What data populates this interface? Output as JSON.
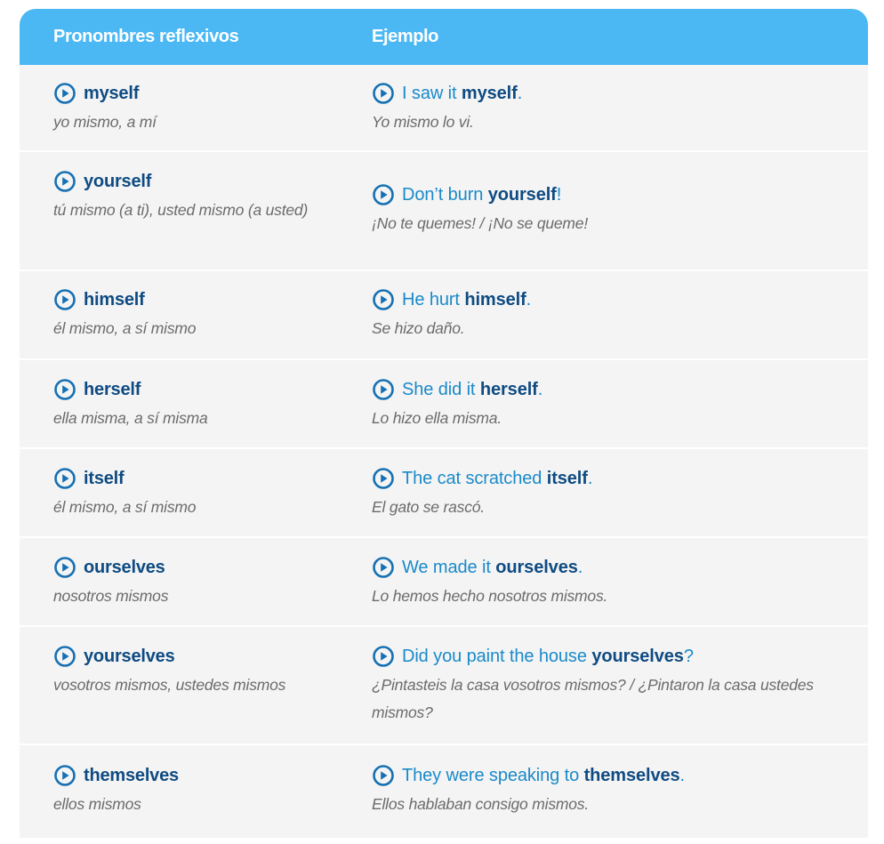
{
  "header": {
    "col1": "Pronombres reflexivos",
    "col2": "Ejemplo"
  },
  "icons": {
    "play": "play-circle-icon"
  },
  "colors": {
    "header_bg": "#4bb8f4",
    "row_bg": "#f4f4f4",
    "word": "#0f4b82",
    "sentence": "#1a8ac9",
    "translation": "#6b6b6b"
  },
  "rows": [
    {
      "pronoun": "myself",
      "pronoun_translation": "yo mismo, a mí",
      "ex_pre": "I saw it ",
      "ex_bold": "myself",
      "ex_post": ".",
      "ex_translation": "Yo mismo lo vi."
    },
    {
      "pronoun": "yourself",
      "pronoun_translation": "tú mismo (a ti), usted mismo (a usted)",
      "ex_pre": "Don’t burn ",
      "ex_bold": "yourself",
      "ex_post": "!",
      "ex_translation": "¡No te quemes! / ¡No se queme!"
    },
    {
      "pronoun": "himself",
      "pronoun_translation": "él mismo, a sí mismo",
      "ex_pre": "He hurt ",
      "ex_bold": "himself",
      "ex_post": ".",
      "ex_translation": "Se hizo daño."
    },
    {
      "pronoun": "herself",
      "pronoun_translation": "ella misma, a sí misma",
      "ex_pre": "She did it ",
      "ex_bold": "herself",
      "ex_post": ".",
      "ex_translation": "Lo hizo ella misma."
    },
    {
      "pronoun": "itself",
      "pronoun_translation": "él mismo, a sí mismo",
      "ex_pre": "The cat scratched ",
      "ex_bold": "itself",
      "ex_post": ".",
      "ex_translation": "El gato se rascó."
    },
    {
      "pronoun": "ourselves",
      "pronoun_translation": "nosotros mismos",
      "ex_pre": "We made it ",
      "ex_bold": "ourselves",
      "ex_post": ".",
      "ex_translation": "Lo hemos hecho nosotros mismos."
    },
    {
      "pronoun": "yourselves",
      "pronoun_translation": "vosotros mismos, ustedes mismos",
      "ex_pre": "Did you paint the house ",
      "ex_bold": "yourselves",
      "ex_post": "?",
      "ex_translation": "¿Pintasteis la casa vosotros mismos? / ¿Pintaron la casa ustedes mismos?"
    },
    {
      "pronoun": "themselves",
      "pronoun_translation": "ellos mismos",
      "ex_pre": "They were speaking to ",
      "ex_bold": "themselves",
      "ex_post": ".",
      "ex_translation": "Ellos hablaban consigo mismos."
    }
  ]
}
